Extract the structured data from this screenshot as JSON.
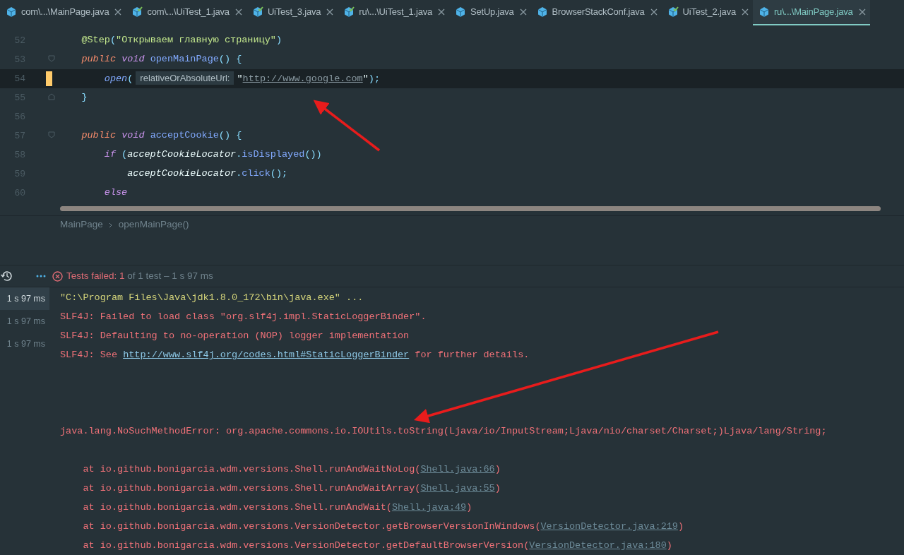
{
  "tabs": [
    {
      "label": "com\\...\\MainPage.java",
      "kind": "class",
      "selected": false
    },
    {
      "label": "com\\...\\UiTest_1.java",
      "kind": "test",
      "selected": false
    },
    {
      "label": "UiTest_3.java",
      "kind": "test",
      "selected": false
    },
    {
      "label": "ru\\...\\UiTest_1.java",
      "kind": "test",
      "selected": false
    },
    {
      "label": "SetUp.java",
      "kind": "class",
      "selected": false
    },
    {
      "label": "BrowserStackConf.java",
      "kind": "class",
      "selected": false
    },
    {
      "label": "UiTest_2.java",
      "kind": "test",
      "selected": false
    },
    {
      "label": "ru\\...\\MainPage.java",
      "kind": "class",
      "selected": true
    }
  ],
  "code_lines": [
    {
      "number": "52",
      "current": false,
      "modified": false,
      "fold_start": false,
      "fold_end": false,
      "tokens": [
        {
          "text": "    @Step",
          "kind": "annotation"
        },
        {
          "text": "(",
          "kind": "punct"
        },
        {
          "text": "\"Открываем главную страницу\"",
          "kind": "string"
        },
        {
          "text": ")",
          "kind": "punct"
        }
      ]
    },
    {
      "number": "53",
      "current": false,
      "modified": false,
      "fold_start": true,
      "fold_end": false,
      "tokens": [
        {
          "text": "    public ",
          "kind": "modifier"
        },
        {
          "text": "void ",
          "kind": "keyword"
        },
        {
          "text": "openMainPage",
          "kind": "method"
        },
        {
          "text": "() {",
          "kind": "punct"
        }
      ]
    },
    {
      "number": "54",
      "current": true,
      "modified": true,
      "fold_start": false,
      "fold_end": false,
      "tokens": [
        {
          "text": "        open",
          "kind": "call"
        },
        {
          "text": "(",
          "kind": "punct"
        },
        {
          "text": "relativeOrAbsoluteUrl:",
          "kind": "hint"
        },
        {
          "text": "\"",
          "kind": "plain"
        },
        {
          "text": "http://www.google.com",
          "kind": "url"
        },
        {
          "text": "\"",
          "kind": "plain"
        },
        {
          "text": ");",
          "kind": "punct"
        }
      ]
    },
    {
      "number": "55",
      "current": false,
      "modified": false,
      "fold_start": false,
      "fold_end": true,
      "tokens": [
        {
          "text": "    }",
          "kind": "punct"
        }
      ]
    },
    {
      "number": "56",
      "current": false,
      "modified": false,
      "fold_start": false,
      "fold_end": false
    },
    {
      "number": "57",
      "current": false,
      "modified": false,
      "fold_start": true,
      "fold_end": false,
      "tokens": [
        {
          "text": "    public ",
          "kind": "modifier"
        },
        {
          "text": "void ",
          "kind": "keyword"
        },
        {
          "text": "acceptCookie",
          "kind": "method"
        },
        {
          "text": "() {",
          "kind": "punct"
        }
      ]
    },
    {
      "number": "58",
      "current": false,
      "modified": false,
      "fold_start": false,
      "fold_end": false,
      "tokens": [
        {
          "text": "        if",
          "kind": "keyword"
        },
        {
          "text": " (",
          "kind": "punct"
        },
        {
          "text": "acceptCookieLocator",
          "kind": "field"
        },
        {
          "text": ".",
          "kind": "punct"
        },
        {
          "text": "isDisplayed",
          "kind": "method"
        },
        {
          "text": "())",
          "kind": "punct"
        }
      ]
    },
    {
      "number": "59",
      "current": false,
      "modified": false,
      "fold_start": false,
      "fold_end": false,
      "tokens": [
        {
          "text": "            acceptCookieLocator",
          "kind": "field"
        },
        {
          "text": ".",
          "kind": "punct"
        },
        {
          "text": "click",
          "kind": "method"
        },
        {
          "text": "();",
          "kind": "punct"
        }
      ]
    },
    {
      "number": "60",
      "current": false,
      "modified": false,
      "fold_start": false,
      "fold_end": false,
      "tokens": [
        {
          "text": "        else",
          "kind": "keyword"
        }
      ]
    }
  ],
  "breadcrumbs": [
    "MainPage",
    "openMainPage()"
  ],
  "test_status": {
    "label": "Tests failed:",
    "count": "1",
    "summary": "of 1 test – 1 s 97 ms"
  },
  "durations": [
    {
      "text": "1 s 97 ms",
      "selected": true
    },
    {
      "text": "1 s 97 ms",
      "selected": false
    },
    {
      "text": "1 s 97 ms",
      "selected": false
    }
  ],
  "console": [
    {
      "kind": "command",
      "segments": [
        {
          "text": "\"C:\\Program Files\\Java\\jdk1.8.0_172\\bin\\java.exe\" ..."
        }
      ]
    },
    {
      "kind": "error",
      "segments": [
        {
          "text": "SLF4J: Failed to load class \"org.slf4j.impl.StaticLoggerBinder\"."
        }
      ]
    },
    {
      "kind": "error",
      "segments": [
        {
          "text": "SLF4J: Defaulting to no-operation (NOP) logger implementation"
        }
      ]
    },
    {
      "kind": "error",
      "segments": [
        {
          "text": "SLF4J: See "
        },
        {
          "text": "http://www.slf4j.org/codes.html#StaticLoggerBinder",
          "link": true
        },
        {
          "text": " for further details."
        }
      ]
    },
    {
      "kind": "blank"
    },
    {
      "kind": "blank"
    },
    {
      "kind": "blank"
    },
    {
      "kind": "error",
      "segments": [
        {
          "text": "java.lang.NoSuchMethodError: org.apache.commons.io.IOUtils.toString(Ljava/io/InputStream;Ljava/nio/charset/Charset;)Ljava/lang/String;"
        }
      ]
    },
    {
      "kind": "blank"
    },
    {
      "kind": "error",
      "segments": [
        {
          "text": "    at io.github.bonigarcia.wdm.versions.Shell.runAndWaitNoLog("
        },
        {
          "text": "Shell.java:66",
          "link": true
        },
        {
          "text": ")"
        }
      ]
    },
    {
      "kind": "error",
      "segments": [
        {
          "text": "    at io.github.bonigarcia.wdm.versions.Shell.runAndWaitArray("
        },
        {
          "text": "Shell.java:55",
          "link": true
        },
        {
          "text": ")"
        }
      ]
    },
    {
      "kind": "error",
      "segments": [
        {
          "text": "    at io.github.bonigarcia.wdm.versions.Shell.runAndWait("
        },
        {
          "text": "Shell.java:49",
          "link": true
        },
        {
          "text": ")"
        }
      ]
    },
    {
      "kind": "error",
      "segments": [
        {
          "text": "    at io.github.bonigarcia.wdm.versions.VersionDetector.getBrowserVersionInWindows("
        },
        {
          "text": "VersionDetector.java:219",
          "link": true
        },
        {
          "text": ")"
        }
      ]
    },
    {
      "kind": "error",
      "segments": [
        {
          "text": "    at io.github.bonigarcia.wdm.versions.VersionDetector.getDefaultBrowserVersion("
        },
        {
          "text": "VersionDetector.java:180",
          "link": true
        },
        {
          "text": ")"
        }
      ]
    }
  ]
}
